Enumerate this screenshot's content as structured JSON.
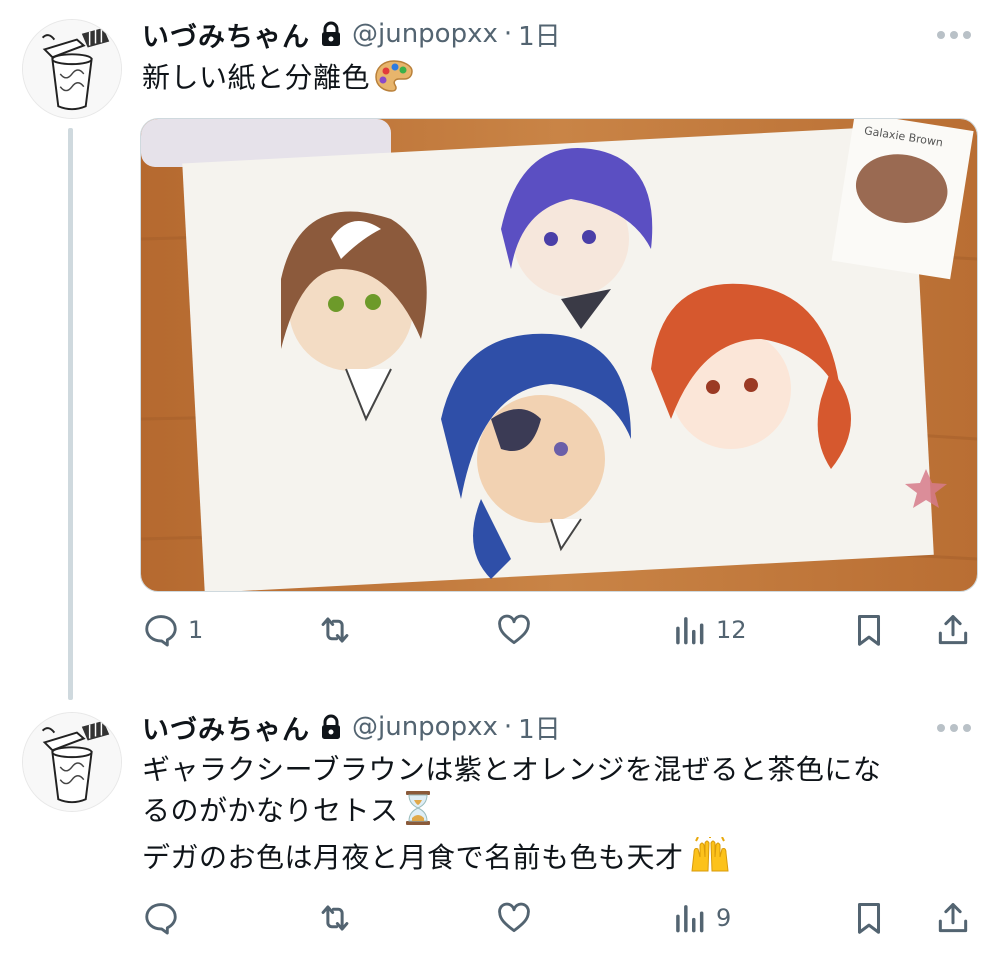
{
  "tweets": [
    {
      "display_name": "いづみちゃん",
      "handle": "@junpopxx",
      "separator": "·",
      "time": "1日",
      "text_lines": [
        "新しい紙と分離色"
      ],
      "emoji_icons": [
        "artist-palette-icon"
      ],
      "image_texts": [
        "Galaxie Brown"
      ],
      "reply_count": "1",
      "retweet_count": "",
      "like_count": "",
      "view_count": "12"
    },
    {
      "display_name": "いづみちゃん",
      "handle": "@junpopxx",
      "separator": "·",
      "time": "1日",
      "text_lines": [
        "ギャラクシーブラウンは紫とオレンジを混ぜると茶色にな",
        "るのがかなりセトス",
        "デガのお色は月夜と月食で名前も色も天才"
      ],
      "emoji_icons": [
        "hourglass-icon",
        "raising-hands-icon"
      ],
      "reply_count": "",
      "retweet_count": "",
      "like_count": "",
      "view_count": "9"
    }
  ],
  "colors": {
    "text": "#0f1419",
    "secondary": "#536471",
    "thread_line": "#cfd9de",
    "background": "#ffffff"
  }
}
